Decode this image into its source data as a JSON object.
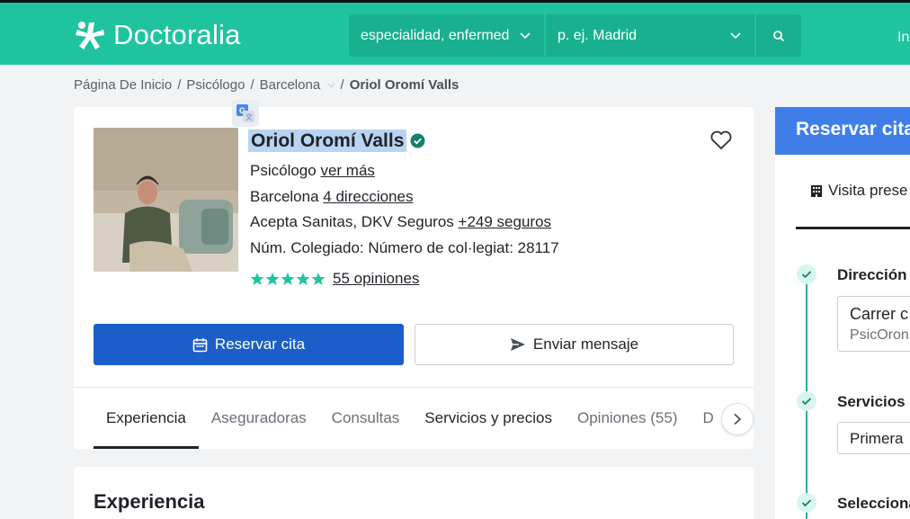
{
  "header": {
    "brand": "Doctoralia",
    "search_specialty": "especialidad, enfermed",
    "search_location": "p. ej. Madrid",
    "top_right_text": "In",
    "brand_color": "#1fc49f"
  },
  "breadcrumb": {
    "items": [
      "Página De Inicio",
      "Psicólogo",
      "Barcelona"
    ],
    "current": "Oriol Oromí Valls",
    "separator": "/"
  },
  "profile": {
    "name": "Oriol Oromí Valls",
    "specialty": "Psicólogo",
    "specialty_link": "ver más",
    "city": "Barcelona",
    "addresses_link": "4 direcciones",
    "insurance_text": "Acepta Sanitas, DKV Seguros",
    "insurance_link": "+249 seguros",
    "license": "Núm. Colegiado: Número de col·legiat: 28117",
    "rating_stars": 5,
    "reviews_link": "55 opiniones",
    "book_button": "Reservar cita",
    "message_button": "Enviar mensaje",
    "accent_color": "#1c5ec9"
  },
  "tabs": [
    {
      "label": "Experiencia"
    },
    {
      "label": "Aseguradoras"
    },
    {
      "label": "Consultas"
    },
    {
      "label": "Servicios y precios"
    },
    {
      "label": "Opiniones (55)"
    },
    {
      "label": "D"
    }
  ],
  "section": {
    "title": "Experiencia"
  },
  "booking": {
    "title": "Reservar cita",
    "visit_tab": "Visita prese",
    "step1_label": "Dirección",
    "address_line1": "Carrer c",
    "address_line2": "PsicOron",
    "step2_label": "Servicios",
    "service_value": "Primera",
    "step3_label": "Selecciona"
  }
}
